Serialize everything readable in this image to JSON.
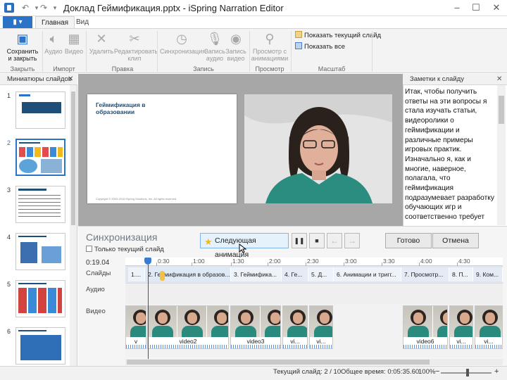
{
  "window": {
    "title": "Доклад Геймификация.pptx - iSpring Narration Editor",
    "minimize_icon": "minimize-icon",
    "maximize_icon": "maximize-icon",
    "close_icon": "close-icon"
  },
  "quick_access": {
    "undo": "↶",
    "redo": "↷",
    "more": "▾"
  },
  "tabs": {
    "file": "▮ ▾",
    "home": "Главная",
    "view": "Вид"
  },
  "ribbon": {
    "groups": {
      "close": "Закрыть",
      "import": "Импорт",
      "edit": "Правка",
      "record": "Запись",
      "preview": "Просмотр",
      "zoom": "Масштаб"
    },
    "buttons": {
      "save_close": "Сохранить и закрыть",
      "audio": "Аудио",
      "video": "Видео",
      "delete": "Удалить",
      "edit_clip": "Редактировать клип",
      "sync": "Синхронизация",
      "record_audio": "Запись аудио",
      "record_video": "Запись видео",
      "preview_anim": "Просмотр с анимациями",
      "show_current": "Показать текущий слайд",
      "show_all": "Показать все"
    }
  },
  "left_panel": {
    "title": "Миниатюры слайдов",
    "thumbnails": [
      "1",
      "2",
      "3",
      "4",
      "5",
      "6"
    ],
    "selected": "2"
  },
  "slide": {
    "title": "Геймификация в образовании",
    "footer": "Copyright © 2003-2016 iSpring Solutions, Inc. All rights reserved."
  },
  "notes": {
    "title": "Заметки к слайду",
    "text": "Итак, чтобы получить ответы на эти вопросы я стала изучать статьи, видеоролики о геймификации и различные примеры игровых практик. Изначально я, как и многие, наверное, полагала, что геймификация подразумевает разработку обучающих игр и соответственно требует знания языков программирования или привлечения специалистов. Однако, как оказалось, обучающие игры и геймификация – это разные"
  },
  "sync": {
    "title": "Синхронизация",
    "only_current": "Только текущий слайд",
    "next_animation": "Следующая анимация",
    "pause": "❚❚",
    "stop": "■",
    "prev": "←",
    "next": "→",
    "done": "Готово",
    "cancel": "Отмена",
    "time": "0:19.04",
    "tracks": {
      "slides": "Слайды",
      "audio": "Аудио",
      "video": "Видео"
    }
  },
  "timeline": {
    "ticks": [
      "0:30",
      "1:00",
      "1:30",
      "2:00",
      "2:30",
      "3:00",
      "3:30",
      "4:00",
      "4:30"
    ],
    "segments": [
      "1....",
      "2. Геймификация в образов...",
      "3. Геймифика...",
      "4. Ге...",
      "5. Д...",
      "6. Анимации и тригг...",
      "7. Просмотр...",
      "8. П...",
      "9. Ком..."
    ],
    "clips": [
      "v",
      "video2",
      "video3",
      "vi...",
      "vi...",
      "video6",
      "vi...",
      "vi..."
    ]
  },
  "status": {
    "current_slide": "Текущий слайд: 2 / 10",
    "total_time": "Общее время: 0:05:35.60",
    "zoom": "100%",
    "zoom_out": "−",
    "zoom_in": "+"
  }
}
